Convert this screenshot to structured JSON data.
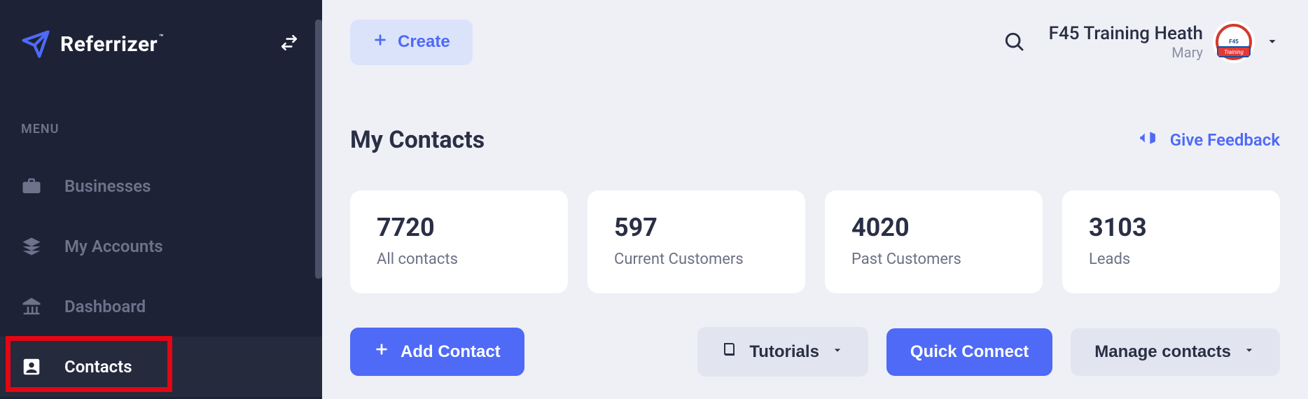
{
  "brand": {
    "name": "Referrizer"
  },
  "sidebar": {
    "menu_label": "MENU",
    "items": [
      {
        "label": "Businesses"
      },
      {
        "label": "My Accounts"
      },
      {
        "label": "Dashboard"
      },
      {
        "label": "Contacts"
      }
    ]
  },
  "header": {
    "create_label": "Create",
    "account_name": "F45 Training Heath",
    "account_user": "Mary",
    "logo_main": "F45",
    "logo_banner": "Training"
  },
  "page": {
    "title": "My Contacts",
    "feedback_label": "Give Feedback"
  },
  "stats": [
    {
      "value": "7720",
      "label": "All contacts"
    },
    {
      "value": "597",
      "label": "Current Customers"
    },
    {
      "value": "4020",
      "label": "Past Customers"
    },
    {
      "value": "3103",
      "label": "Leads"
    }
  ],
  "actions": {
    "add_contact": "Add Contact",
    "tutorials": "Tutorials",
    "quick_connect": "Quick Connect",
    "manage_contacts": "Manage contacts"
  }
}
